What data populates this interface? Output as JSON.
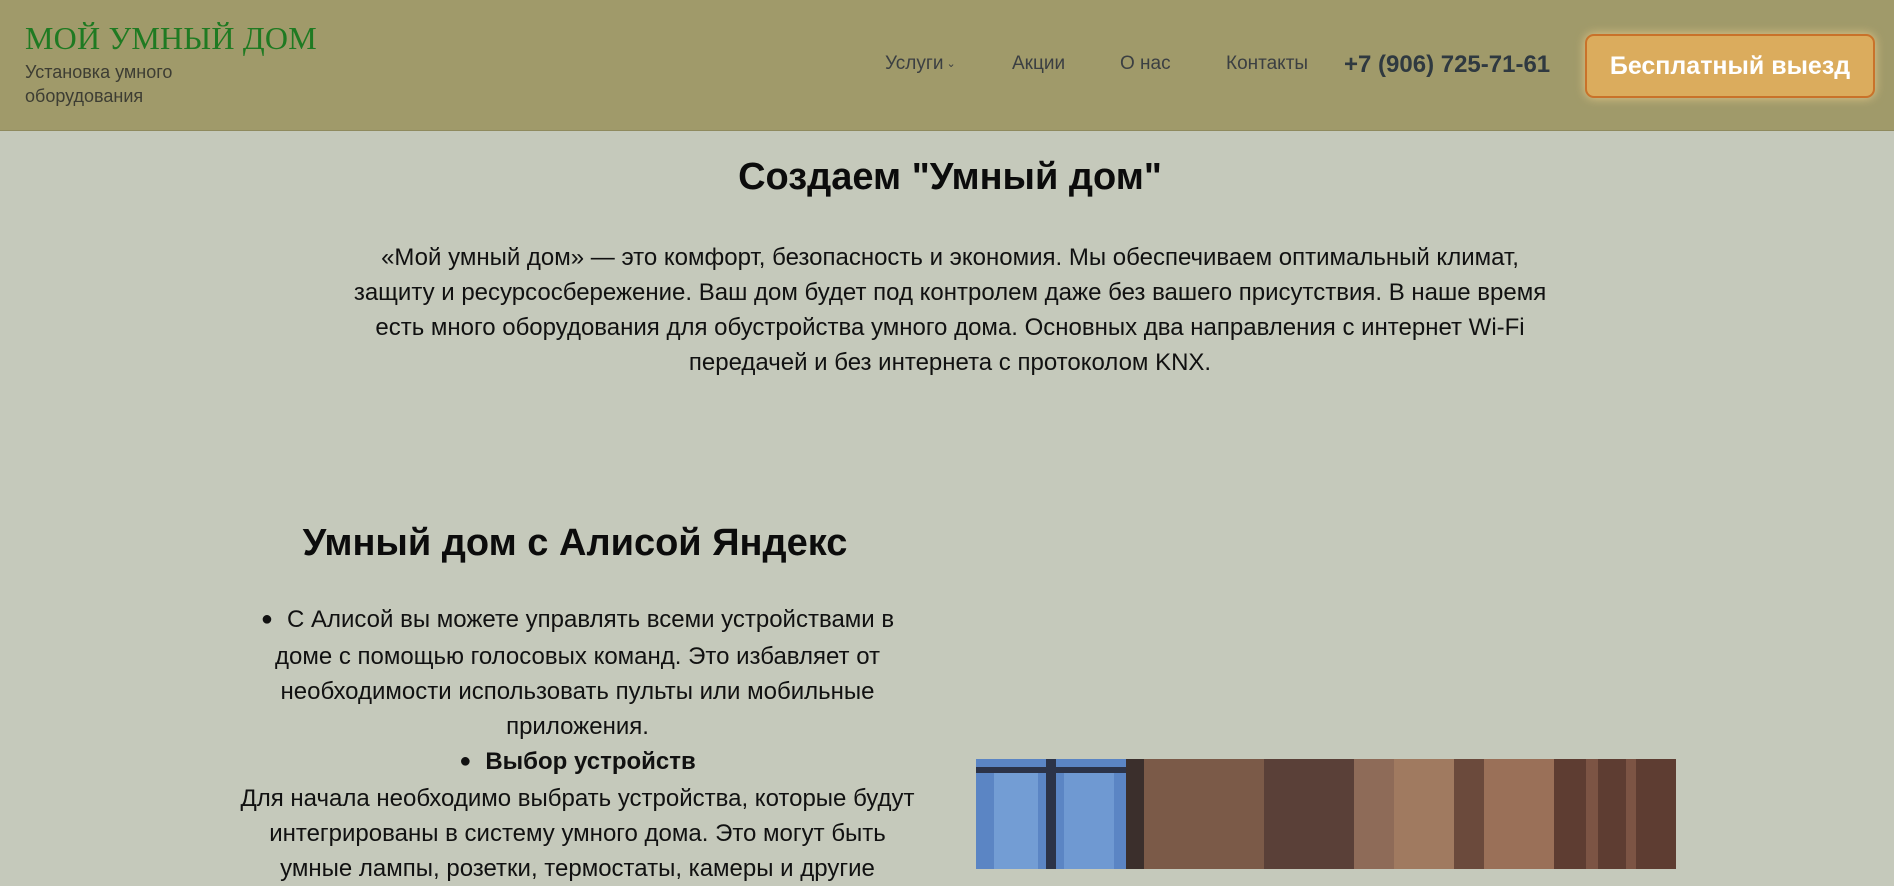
{
  "header": {
    "logo_title": "МОЙ УМНЫЙ ДОМ",
    "logo_subtitle": "Установка умного оборудования",
    "nav": [
      {
        "label": "Услуги",
        "has_dropdown": true
      },
      {
        "label": "Акции"
      },
      {
        "label": "О нас"
      },
      {
        "label": "Контакты"
      }
    ],
    "phone": "+7 (906) 725-71-61",
    "cta_label": "Бесплатный выезд"
  },
  "hero": {
    "title": "Создаем \"Умный дом\"",
    "text": "«Мой умный дом» — это комфорт, безопасность и экономия. Мы обеспечиваем оптимальный климат, защиту и ресурсосбережение. Ваш дом будет под контролем даже без вашего присутствия. В наше время есть много оборудования для обустройства умного дома. Основных два направления с интернет Wi-Fi передачей и без интернета с протоколом KNX."
  },
  "alice": {
    "title": "Умный дом с Алисой Яндекс",
    "item1": "С Алисой вы можете управлять всеми устройствами в доме с помощью голосовых команд. Это избавляет от необходимости использовать пульты или мобильные приложения.",
    "item2_title": "Выбор устройств",
    "item2_text": "Для начала необходимо выбрать устройства, которые будут интегрированы в систему умного дома. Это могут быть умные лампы, розетки, термостаты, камеры и другие"
  },
  "colors": {
    "header_bg": "#a09a6a",
    "page_bg": "#c5c9bb",
    "logo_green": "#1f7a22",
    "cta_bg": "#dbac5d",
    "cta_border": "#c9722a"
  }
}
